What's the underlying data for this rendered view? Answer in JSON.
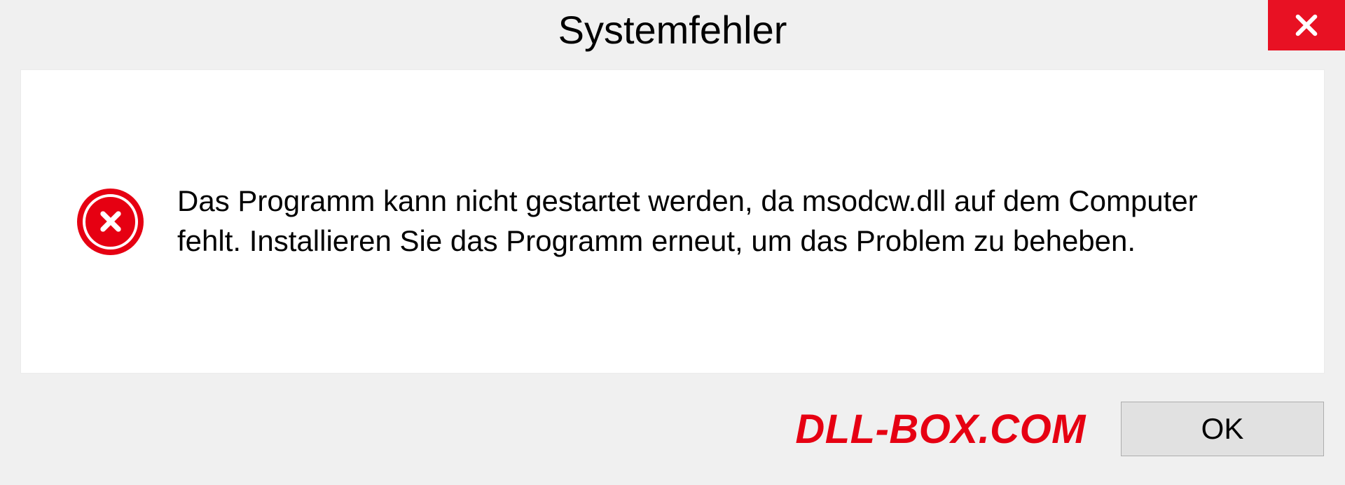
{
  "dialog": {
    "title": "Systemfehler",
    "message": "Das Programm kann nicht gestartet werden, da msodcw.dll auf dem Computer fehlt. Installieren Sie das Programm erneut, um das Problem zu beheben.",
    "ok_label": "OK"
  },
  "watermark": "DLL-BOX.COM",
  "colors": {
    "close_red": "#e81123",
    "error_red": "#e60012",
    "bg": "#f0f0f0"
  }
}
